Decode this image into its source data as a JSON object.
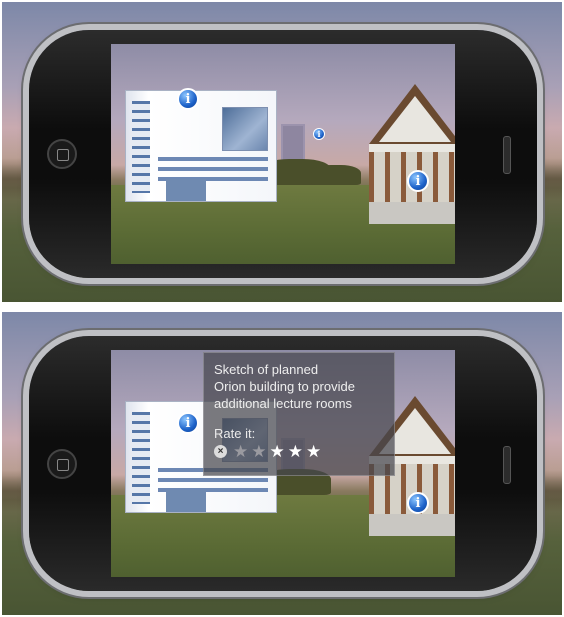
{
  "screens": {
    "top": {
      "markers": [
        {
          "name": "info-icon-lecture-building",
          "glyph": "i"
        },
        {
          "name": "info-icon-tower",
          "glyph": "i"
        },
        {
          "name": "info-icon-house",
          "glyph": "i"
        }
      ]
    },
    "bottom": {
      "popup": {
        "description_line1": "Sketch of planned",
        "description_line2": "Orion building to provide",
        "description_line3": "additional lecture rooms",
        "rate_label": "Rate it:",
        "close_glyph": "×",
        "star_glyph": "★",
        "rating": {
          "value": 3,
          "max": 5
        }
      }
    }
  },
  "colors": {
    "info_marker": "#1d62c9",
    "popup_background": "#46464e",
    "popup_text": "#eeeeee"
  }
}
